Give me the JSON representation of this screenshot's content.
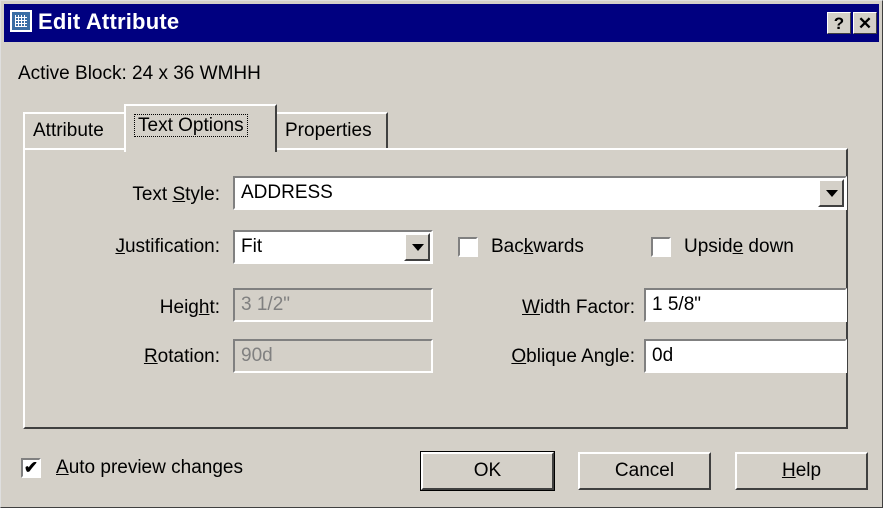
{
  "window": {
    "title": "Edit Attribute",
    "help_btn": "?",
    "close_btn": "✕"
  },
  "active_block": "Active Block: 24 x 36 WMHH",
  "tabs": [
    {
      "label": "Attribute"
    },
    {
      "label": "Text Options",
      "active": true
    },
    {
      "label": "Properties"
    }
  ],
  "form": {
    "text_style": {
      "label_pre": "Text ",
      "label_u": "S",
      "label_post": "tyle:",
      "value": "ADDRESS"
    },
    "justification": {
      "label_pre": "",
      "label_u": "J",
      "label_post": "ustification:",
      "value": "Fit"
    },
    "backwards": {
      "label_pre": "Bac",
      "label_u": "k",
      "label_post": "wards",
      "checked": false
    },
    "upside_down": {
      "label_pre": "Upsid",
      "label_u": "e",
      "label_post": " down",
      "checked": false
    },
    "height": {
      "label_pre": "Heig",
      "label_u": "h",
      "label_post": "t:",
      "value": "3 1/2\""
    },
    "width_factor": {
      "label_pre": "",
      "label_u": "W",
      "label_post": "idth Factor:",
      "value": "1 5/8\""
    },
    "rotation": {
      "label_pre": "",
      "label_u": "R",
      "label_post": "otation:",
      "value": "90d"
    },
    "oblique": {
      "label_pre": "",
      "label_u": "O",
      "label_post": "blique Angle:",
      "value": "0d"
    }
  },
  "auto_preview": {
    "label_pre": "",
    "label_u": "A",
    "label_post": "uto preview changes",
    "checked": true,
    "mark": "✔"
  },
  "buttons": {
    "ok": "OK",
    "cancel": "Cancel",
    "help_pre": "",
    "help_u": "H",
    "help_post": "elp"
  }
}
